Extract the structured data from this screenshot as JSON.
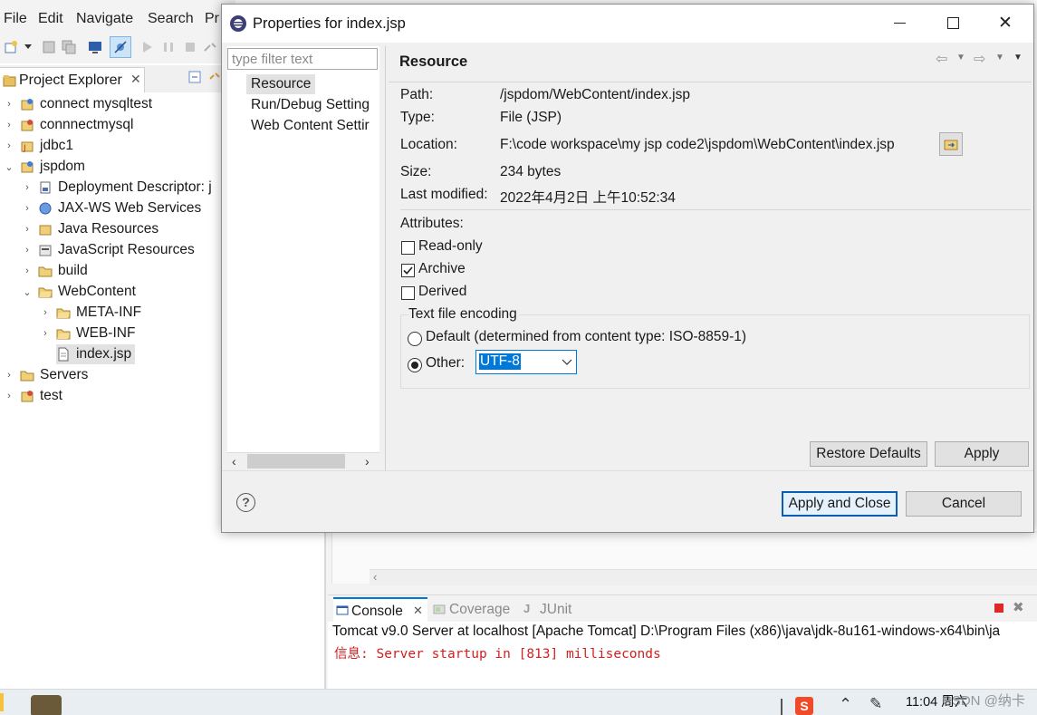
{
  "eclipse": {
    "menu": [
      "File",
      "Edit",
      "Navigate",
      "Search",
      "Pr"
    ],
    "project_explorer": {
      "title": "Project Explorer",
      "tree": [
        {
          "label": "connect mysqltest",
          "indent": 0,
          "expanded": false
        },
        {
          "label": "connnectmysql",
          "indent": 0,
          "expanded": false
        },
        {
          "label": "jdbc1",
          "indent": 0,
          "expanded": false
        },
        {
          "label": "jspdom",
          "indent": 0,
          "expanded": true
        },
        {
          "label": "Deployment Descriptor: j",
          "indent": 1,
          "expanded": false
        },
        {
          "label": "JAX-WS Web Services",
          "indent": 1,
          "expanded": false
        },
        {
          "label": "Java Resources",
          "indent": 1,
          "expanded": false
        },
        {
          "label": "JavaScript Resources",
          "indent": 1,
          "expanded": false
        },
        {
          "label": "build",
          "indent": 1,
          "expanded": false
        },
        {
          "label": "WebContent",
          "indent": 1,
          "expanded": true
        },
        {
          "label": "META-INF",
          "indent": 2,
          "expanded": false
        },
        {
          "label": "WEB-INF",
          "indent": 2,
          "expanded": false
        },
        {
          "label": "index.jsp",
          "indent": 2,
          "selected": true
        },
        {
          "label": "Servers",
          "indent": 0,
          "expanded": false
        },
        {
          "label": "test",
          "indent": 0,
          "expanded": false
        }
      ]
    },
    "console": {
      "tabs": [
        "Console",
        "Coverage",
        "JUnit"
      ],
      "header_line": "Tomcat v9.0 Server at localhost [Apache Tomcat] D:\\Program Files (x86)\\java\\jdk-8u161-windows-x64\\bin\\ja",
      "log_line": "信息: Server startup in [813] milliseconds"
    },
    "taskbar": {
      "clock": "11:04 周六",
      "watermark": "CSDN @纳卡"
    }
  },
  "dialog": {
    "title": "Properties for index.jsp",
    "filter_placeholder": "type filter text",
    "nav_items": [
      "Resource",
      "Run/Debug Setting",
      "Web Content Settir"
    ],
    "page_title": "Resource",
    "fields": {
      "path_label": "Path:",
      "path_value": "/jspdom/WebContent/index.jsp",
      "type_label": "Type:",
      "type_value": "File  (JSP)",
      "location_label": "Location:",
      "location_value": "F:\\code  workspace\\my jsp code2\\jspdom\\WebContent\\index.jsp",
      "size_label": "Size:",
      "size_value": "234  bytes",
      "modified_label": "Last modified:",
      "modified_value": "2022年4月2日 上午10:52:34"
    },
    "attributes": {
      "heading": "Attributes:",
      "read_only": {
        "label": "Read-only",
        "checked": false
      },
      "archive": {
        "label": "Archive",
        "checked": true
      },
      "derived": {
        "label": "Derived",
        "checked": false
      }
    },
    "encoding": {
      "heading": "Text file encoding",
      "default_label": "Default (determined from content type: ISO-8859-1)",
      "other_label": "Other:",
      "selected": "other",
      "other_value": "UTF-8"
    },
    "buttons": {
      "restore_defaults": "Restore Defaults",
      "apply": "Apply",
      "apply_and_close": "Apply and Close",
      "cancel": "Cancel"
    },
    "colors": {
      "selection": "#0078d7",
      "accent_border": "#0a5fb4"
    }
  }
}
